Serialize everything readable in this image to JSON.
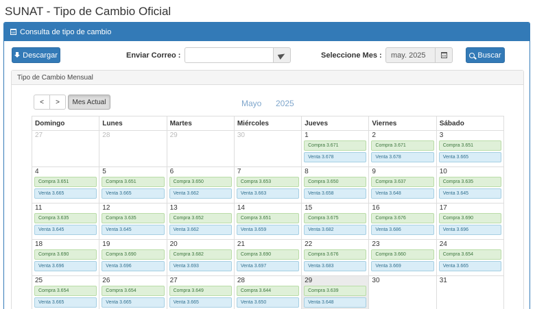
{
  "page_title": "SUNAT - Tipo de Cambio Oficial",
  "panel_title": "Consulta de tipo de cambio",
  "toolbar": {
    "download_label": "Descargar",
    "email_label": "Enviar Correo :",
    "email_value": "",
    "month_label": "Seleccione Mes :",
    "month_value": "may. 2025",
    "search_label": "Buscar"
  },
  "calendar": {
    "section_title": "Tipo de Cambio Mensual",
    "prev_label": "<",
    "next_label": ">",
    "today_label": "Mes Actual",
    "month_name": "Mayo",
    "year": "2025",
    "weekdays": [
      "Domingo",
      "Lunes",
      "Martes",
      "Miércoles",
      "Jueves",
      "Viernes",
      "Sábado"
    ],
    "weeks": [
      [
        {
          "day": "27",
          "other": true
        },
        {
          "day": "28",
          "other": true
        },
        {
          "day": "29",
          "other": true
        },
        {
          "day": "30",
          "other": true
        },
        {
          "day": "1",
          "buy": "Compra 3.671",
          "sell": "Venta 3.678"
        },
        {
          "day": "2",
          "buy": "Compra 3.671",
          "sell": "Venta 3.678"
        },
        {
          "day": "3",
          "buy": "Compra 3.651",
          "sell": "Venta 3.665"
        }
      ],
      [
        {
          "day": "4",
          "buy": "Compra 3.651",
          "sell": "Venta 3.665"
        },
        {
          "day": "5",
          "buy": "Compra 3.651",
          "sell": "Venta 3.665"
        },
        {
          "day": "6",
          "buy": "Compra 3.650",
          "sell": "Venta 3.662"
        },
        {
          "day": "7",
          "buy": "Compra 3.653",
          "sell": "Venta 3.663"
        },
        {
          "day": "8",
          "buy": "Compra 3.650",
          "sell": "Venta 3.658"
        },
        {
          "day": "9",
          "buy": "Compra 3.637",
          "sell": "Venta 3.648"
        },
        {
          "day": "10",
          "buy": "Compra 3.635",
          "sell": "Venta 3.645"
        }
      ],
      [
        {
          "day": "11",
          "buy": "Compra 3.635",
          "sell": "Venta 3.645"
        },
        {
          "day": "12",
          "buy": "Compra 3.635",
          "sell": "Venta 3.645"
        },
        {
          "day": "13",
          "buy": "Compra 3.652",
          "sell": "Venta 3.662"
        },
        {
          "day": "14",
          "buy": "Compra 3.651",
          "sell": "Venta 3.659"
        },
        {
          "day": "15",
          "buy": "Compra 3.675",
          "sell": "Venta 3.682"
        },
        {
          "day": "16",
          "buy": "Compra 3.676",
          "sell": "Venta 3.686"
        },
        {
          "day": "17",
          "buy": "Compra 3.690",
          "sell": "Venta 3.696"
        }
      ],
      [
        {
          "day": "18",
          "buy": "Compra 3.690",
          "sell": "Venta 3.696"
        },
        {
          "day": "19",
          "buy": "Compra 3.690",
          "sell": "Venta 3.696"
        },
        {
          "day": "20",
          "buy": "Compra 3.682",
          "sell": "Venta 3.693"
        },
        {
          "day": "21",
          "buy": "Compra 3.690",
          "sell": "Venta 3.697"
        },
        {
          "day": "22",
          "buy": "Compra 3.676",
          "sell": "Venta 3.683"
        },
        {
          "day": "23",
          "buy": "Compra 3.660",
          "sell": "Venta 3.669"
        },
        {
          "day": "24",
          "buy": "Compra 3.654",
          "sell": "Venta 3.665"
        }
      ],
      [
        {
          "day": "25",
          "buy": "Compra 3.654",
          "sell": "Venta 3.665"
        },
        {
          "day": "26",
          "buy": "Compra 3.654",
          "sell": "Venta 3.665"
        },
        {
          "day": "27",
          "buy": "Compra 3.649",
          "sell": "Venta 3.665"
        },
        {
          "day": "28",
          "buy": "Compra 3.644",
          "sell": "Venta 3.650"
        },
        {
          "day": "29",
          "buy": "Compra 3.639",
          "sell": "Venta 3.648",
          "highlight": true
        },
        {
          "day": "30"
        },
        {
          "day": "31"
        }
      ]
    ]
  }
}
